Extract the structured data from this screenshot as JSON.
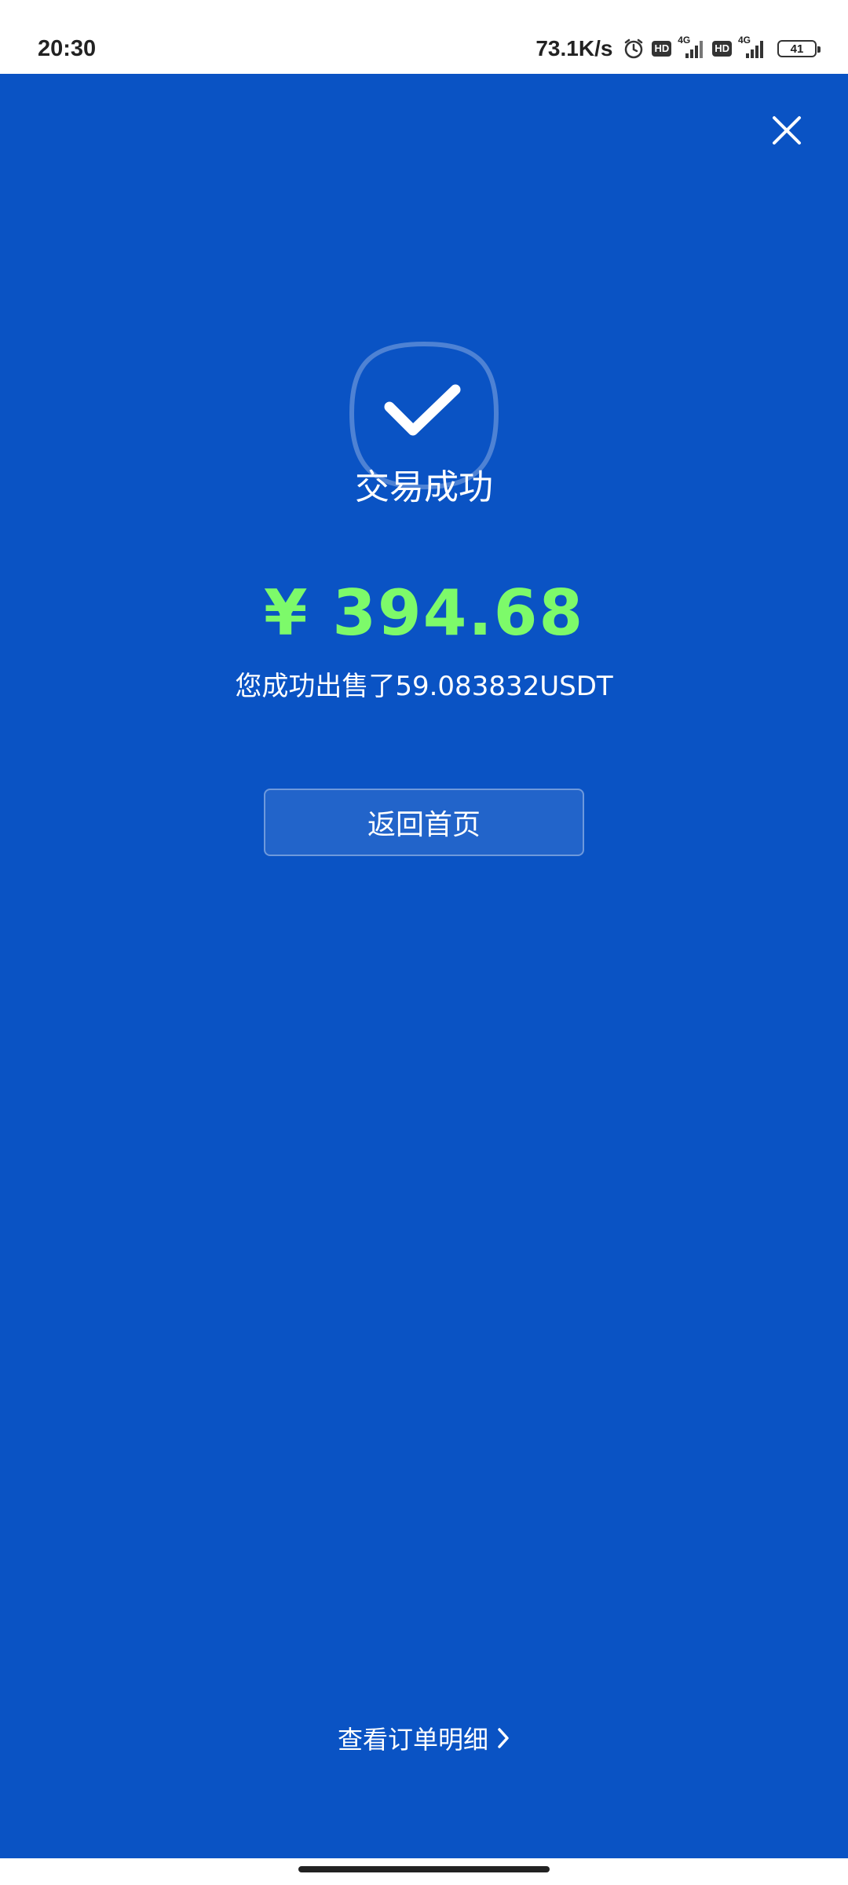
{
  "status_bar": {
    "time": "20:30",
    "net_speed": "73.1K/s",
    "hd1": "HD",
    "net1": "4G",
    "hd2": "HD",
    "net2": "4G",
    "battery": "41"
  },
  "result": {
    "title": "交易成功",
    "amount": "¥ 394.68",
    "description": "您成功出售了59.083832USDT",
    "home_button_label": "返回首页",
    "order_link_label": "查看订单明细"
  },
  "icons": {
    "close": "close-icon",
    "check": "check-icon",
    "chevron": "chevron-right-icon",
    "alarm": "alarm-icon",
    "signal": "signal-icon"
  },
  "colors": {
    "background": "#0a53c4",
    "amount": "#7dfa6a",
    "text": "#ffffff"
  }
}
